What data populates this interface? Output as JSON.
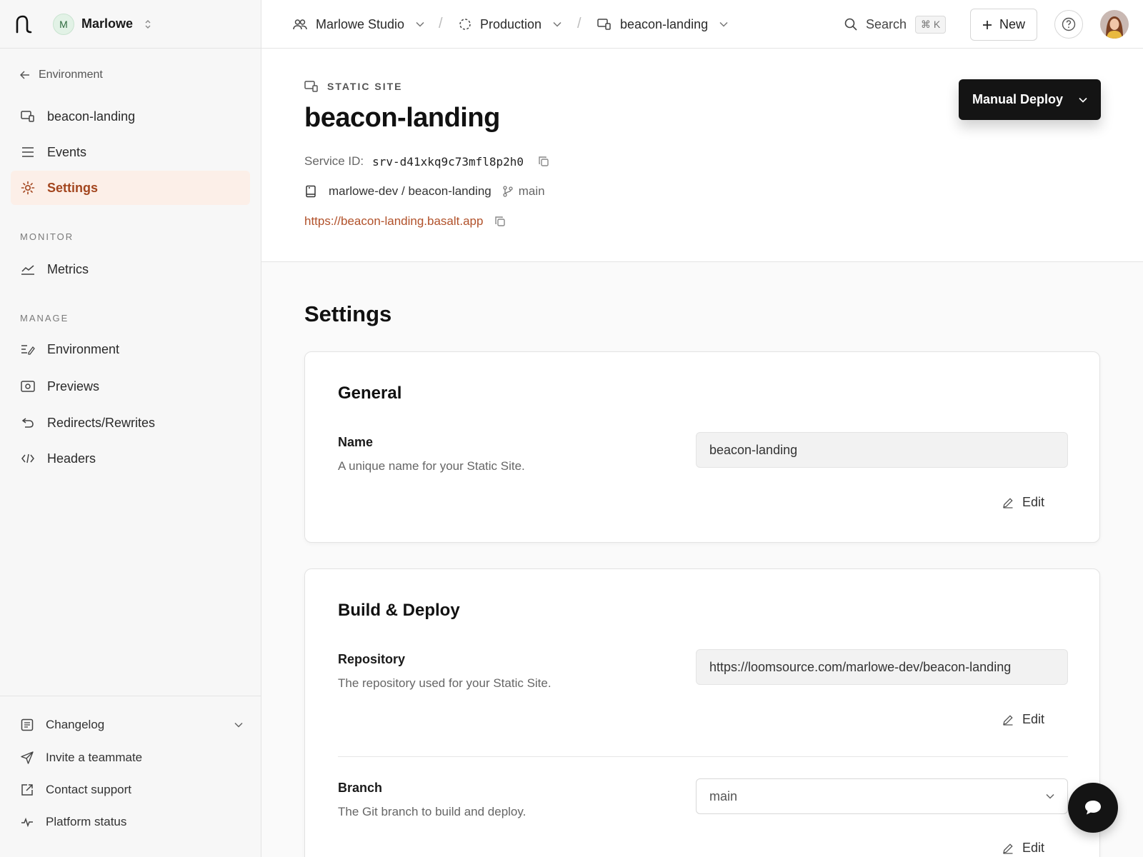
{
  "workspace": {
    "initial": "M",
    "name": "Marlowe"
  },
  "sidebar": {
    "back_label": "Environment",
    "service_label": "beacon-landing",
    "events_label": "Events",
    "settings_label": "Settings",
    "monitor_heading": "MONITOR",
    "metrics_label": "Metrics",
    "manage_heading": "MANAGE",
    "manage_items": [
      "Environment",
      "Previews",
      "Redirects/Rewrites",
      "Headers"
    ],
    "bottom_items": [
      "Changelog",
      "Invite a teammate",
      "Contact support",
      "Platform status"
    ]
  },
  "topbar": {
    "team": "Marlowe Studio",
    "environment": "Production",
    "service": "beacon-landing",
    "separator": "/",
    "search_label": "Search",
    "search_shortcut": "⌘ K",
    "new_label": "New"
  },
  "service": {
    "type_label": "STATIC SITE",
    "name": "beacon-landing",
    "id_label": "Service ID:",
    "id_value": "srv-d41xkq9c73mfl8p2h0",
    "repo": "marlowe-dev / beacon-landing",
    "branch": "main",
    "url": "https://beacon-landing.basalt.app",
    "deploy_label": "Manual Deploy"
  },
  "settings": {
    "title": "Settings",
    "general": {
      "heading": "General",
      "name_label": "Name",
      "name_desc": "A unique name for your Static Site.",
      "name_value": "beacon-landing",
      "edit_label": "Edit"
    },
    "build": {
      "heading": "Build & Deploy",
      "repo_label": "Repository",
      "repo_desc": "The repository used for your Static Site.",
      "repo_value": "https://loomsource.com/marlowe-dev/beacon-landing",
      "branch_label": "Branch",
      "branch_desc": "The Git branch to build and deploy.",
      "branch_value": "main",
      "edit_label": "Edit"
    }
  },
  "colors": {
    "accent": "#b1512a",
    "active_bg": "#fcefe8",
    "dark": "#141414"
  }
}
